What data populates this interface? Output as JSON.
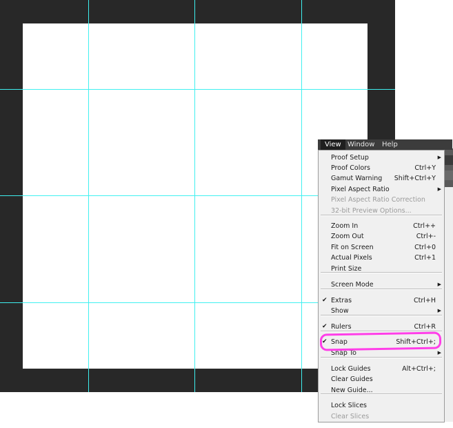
{
  "menubar": {
    "items": [
      {
        "label": "View",
        "active": true
      },
      {
        "label": "Window",
        "active": false
      },
      {
        "label": "Help",
        "active": false
      }
    ]
  },
  "view_menu": {
    "items": [
      {
        "label": "Proof Setup",
        "shortcut": "",
        "submenu": true,
        "checked": false,
        "disabled": false
      },
      {
        "label": "Proof Colors",
        "shortcut": "Ctrl+Y",
        "submenu": false,
        "checked": false,
        "disabled": false
      },
      {
        "label": "Gamut Warning",
        "shortcut": "Shift+Ctrl+Y",
        "submenu": false,
        "checked": false,
        "disabled": false
      },
      {
        "label": "Pixel Aspect Ratio",
        "shortcut": "",
        "submenu": true,
        "checked": false,
        "disabled": false
      },
      {
        "label": "Pixel Aspect Ratio Correction",
        "shortcut": "",
        "submenu": false,
        "checked": false,
        "disabled": true
      },
      {
        "label": "32-bit Preview Options...",
        "shortcut": "",
        "submenu": false,
        "checked": false,
        "disabled": true
      },
      {
        "label": "Zoom In",
        "shortcut": "Ctrl++",
        "submenu": false,
        "checked": false,
        "disabled": false
      },
      {
        "label": "Zoom Out",
        "shortcut": "Ctrl+-",
        "submenu": false,
        "checked": false,
        "disabled": false
      },
      {
        "label": "Fit on Screen",
        "shortcut": "Ctrl+0",
        "submenu": false,
        "checked": false,
        "disabled": false
      },
      {
        "label": "Actual Pixels",
        "shortcut": "Ctrl+1",
        "submenu": false,
        "checked": false,
        "disabled": false
      },
      {
        "label": "Print Size",
        "shortcut": "",
        "submenu": false,
        "checked": false,
        "disabled": false
      },
      {
        "label": "Screen Mode",
        "shortcut": "",
        "submenu": true,
        "checked": false,
        "disabled": false
      },
      {
        "label": "Extras",
        "shortcut": "Ctrl+H",
        "submenu": false,
        "checked": true,
        "disabled": false
      },
      {
        "label": "Show",
        "shortcut": "",
        "submenu": true,
        "checked": false,
        "disabled": false
      },
      {
        "label": "Rulers",
        "shortcut": "Ctrl+R",
        "submenu": false,
        "checked": true,
        "disabled": false
      },
      {
        "label": "Snap",
        "shortcut": "Shift+Ctrl+;",
        "submenu": false,
        "checked": true,
        "disabled": false
      },
      {
        "label": "Snap To",
        "shortcut": "",
        "submenu": true,
        "checked": false,
        "disabled": false
      },
      {
        "label": "Lock Guides",
        "shortcut": "Alt+Ctrl+;",
        "submenu": false,
        "checked": false,
        "disabled": false
      },
      {
        "label": "Clear Guides",
        "shortcut": "",
        "submenu": false,
        "checked": false,
        "disabled": false
      },
      {
        "label": "New Guide...",
        "shortcut": "",
        "submenu": false,
        "checked": false,
        "disabled": false
      },
      {
        "label": "Lock Slices",
        "shortcut": "",
        "submenu": false,
        "checked": false,
        "disabled": false
      },
      {
        "label": "Clear Slices",
        "shortcut": "",
        "submenu": false,
        "checked": false,
        "disabled": true
      }
    ]
  },
  "colors": {
    "workspace": "#282828",
    "guide": "#3ff0f0",
    "annotation": "#ff3ee8"
  }
}
